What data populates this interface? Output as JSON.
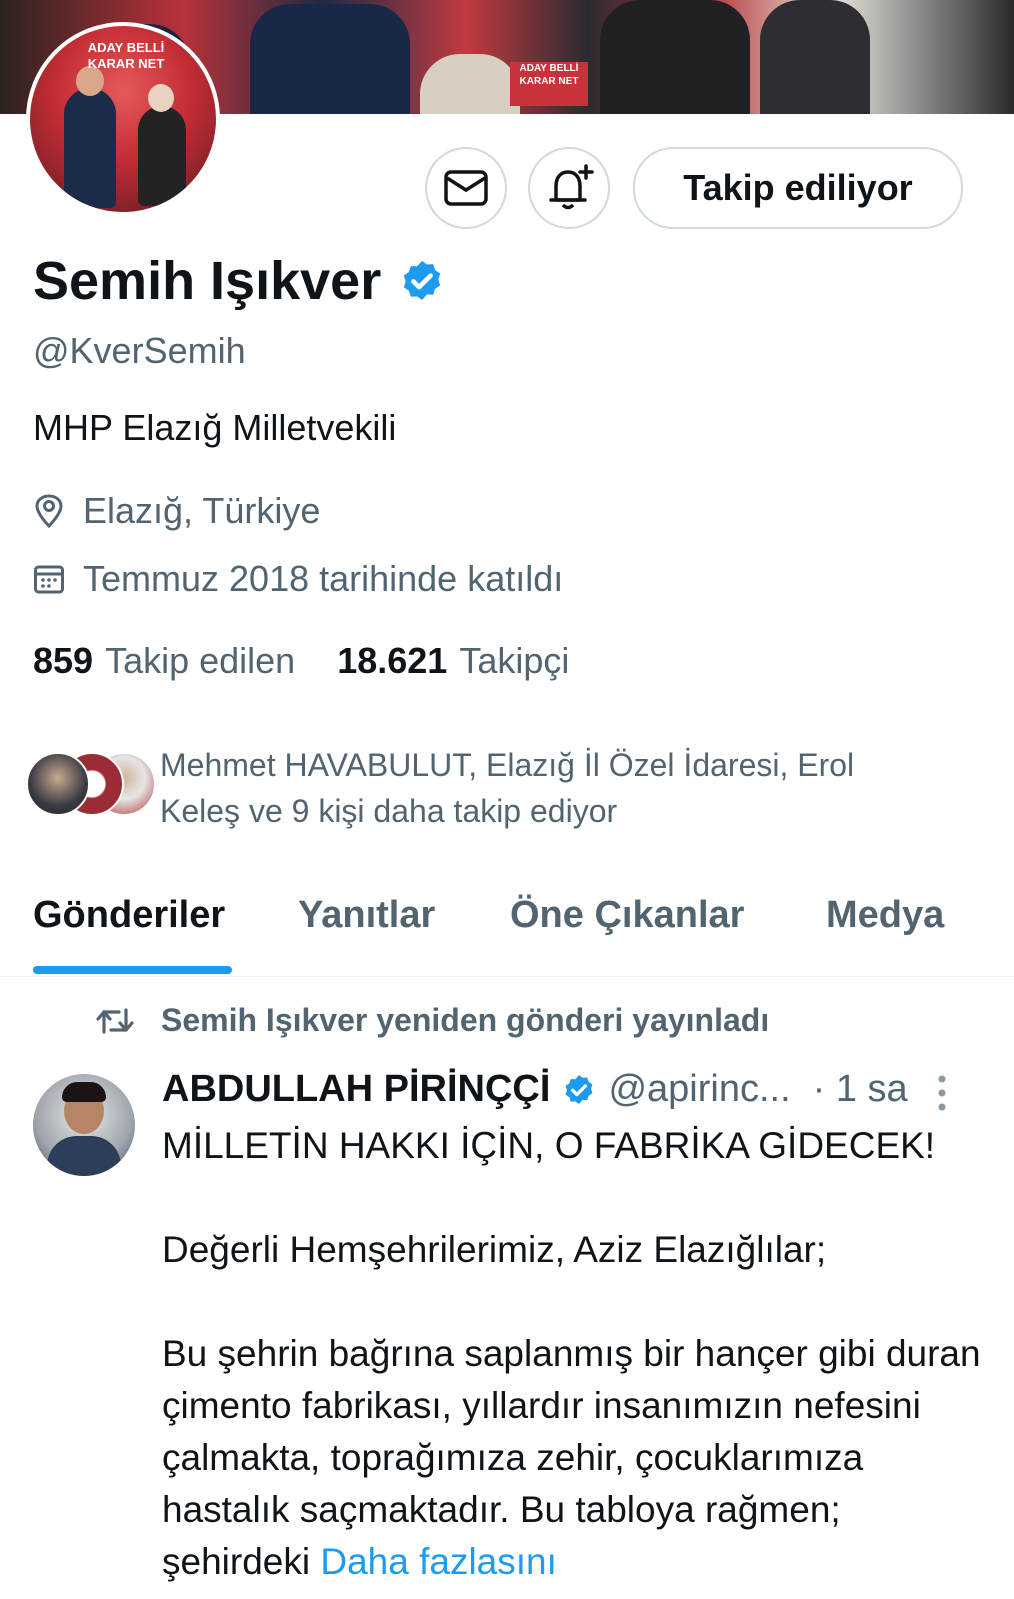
{
  "profile": {
    "name": "Semih Işıkver",
    "handle": "@KverSemih",
    "bio": "MHP Elazığ Milletvekili",
    "location": "Elazığ, Türkiye",
    "joined": "Temmuz 2018 tarihinde katıldı",
    "following_count": "859",
    "following_label": "Takip edilen",
    "followers_count": "18.621",
    "followers_label": "Takipçi",
    "follow_button": "Takip ediliyor",
    "followed_by_text": "Mehmet HAVABULUT, Elazığ İl Özel İdaresi, Erol Keleş ve 9 kişi daha takip ediyor",
    "banner_text": [
      "ADAY BELLİ KARAR NET",
      "ADAY BELLİ KARAR NET"
    ]
  },
  "icons": {
    "message": "mail-icon",
    "notify": "bell-plus-icon",
    "verified": "verified-badge-icon",
    "location": "location-pin-icon",
    "calendar": "calendar-icon",
    "repost": "repost-icon",
    "more": "more-vertical-icon"
  },
  "colors": {
    "accent": "#1d9bf0",
    "text_primary": "#0f1419",
    "text_secondary": "#536471"
  },
  "tabs": [
    {
      "label": "Gönderiler",
      "active": true
    },
    {
      "label": "Yanıtlar",
      "active": false
    },
    {
      "label": "Öne Çıkanlar",
      "active": false
    },
    {
      "label": "Medya",
      "active": false
    }
  ],
  "post": {
    "repost_label": "Semih Işıkver yeniden gönderi yayınladı",
    "author_name": "ABDULLAH PİRİNÇÇİ",
    "author_handle": "@apirinc...",
    "time": "· 1 sa",
    "title": "MİLLETİN HAKKI İÇİN, O FABRİKA GİDECEK!",
    "greeting": "Değerli Hemşehrilerimiz, Aziz Elazığlılar;",
    "body": "Bu şehrin bağrına saplanmış bir hançer gibi duran çimento fabrikası, yıllardır insanımızın nefesini çalmakta, toprağımıza zehir, çocuklarımıza hastalık saçmaktadır. Bu tabloya rağmen; şehirdeki",
    "more_link": "Daha fazlasını"
  }
}
